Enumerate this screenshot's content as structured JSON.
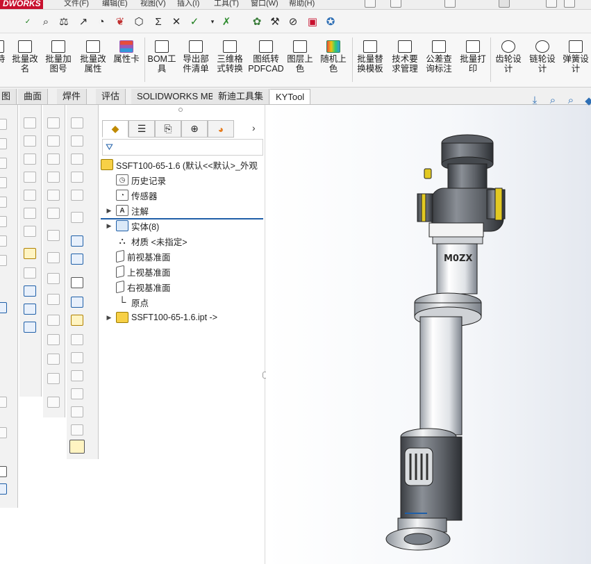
{
  "app": {
    "logo_text": "DWORKS"
  },
  "menu": {
    "items": [
      "文件(F)",
      "编辑(E)",
      "视图(V)",
      "插入(I)",
      "工具(T)",
      "窗口(W)",
      "帮助(H)"
    ]
  },
  "ribbon": {
    "buttons": [
      {
        "label": "持",
        "icon": "partial-icon"
      },
      {
        "label": "批量改\n名",
        "icon": "rename-icon"
      },
      {
        "label": "批量加\n图号",
        "icon": "edit-pencil-icon"
      },
      {
        "label": "批量改\n属性",
        "icon": "list-icon"
      },
      {
        "label": "属性卡",
        "icon": "property-card-icon"
      },
      {
        "label": "BOM工\n具",
        "icon": "table-icon"
      },
      {
        "label": "导出部\n件清单",
        "icon": "export-list-icon"
      },
      {
        "label": "三维格\n式转换",
        "icon": "format-convert-icon"
      },
      {
        "label": "图纸转\nPDFCAD",
        "icon": "pdf-icon"
      },
      {
        "label": "图层上\n色",
        "icon": "layers-icon"
      },
      {
        "label": "随机上\n色",
        "icon": "palette-icon"
      },
      {
        "label": "批量替\n换模板",
        "icon": "template-icon"
      },
      {
        "label": "技术要\n求管理",
        "icon": "requirement-icon"
      },
      {
        "label": "公差查\n询标注",
        "icon": "tolerance-icon"
      },
      {
        "label": "批量打\n印",
        "icon": "printer-icon"
      },
      {
        "label": "齿轮设\n计",
        "icon": "gear-icon"
      },
      {
        "label": "链轮设\n计",
        "icon": "chain-icon"
      },
      {
        "label": "弹簧设\n计",
        "icon": "spring-icon"
      }
    ]
  },
  "tabs": [
    {
      "label": "图",
      "active": false
    },
    {
      "label": "曲面",
      "active": false
    },
    {
      "label": "焊件",
      "active": false
    },
    {
      "label": "评估",
      "active": false
    },
    {
      "label": "SOLIDWORKS MBD",
      "active": false
    },
    {
      "label": "新迪工具集",
      "active": false
    },
    {
      "label": "KYTool",
      "active": true
    }
  ],
  "feature_tree": {
    "root": "SSFT100-65-1.6  (默认<<默认>_外观",
    "items": [
      {
        "label": "历史记录",
        "icon": "history-icon",
        "expandable": false
      },
      {
        "label": "传感器",
        "icon": "sensor-icon",
        "expandable": false
      },
      {
        "label": "注解",
        "icon": "annotation-icon",
        "expandable": true
      },
      {
        "label": "实体(8)",
        "icon": "solid-bodies-icon",
        "expandable": true
      },
      {
        "label": "材质 <未指定>",
        "icon": "material-icon",
        "expandable": false
      },
      {
        "label": "前视基准面",
        "icon": "plane-icon",
        "expandable": false
      },
      {
        "label": "上视基准面",
        "icon": "plane-icon",
        "expandable": false
      },
      {
        "label": "右视基准面",
        "icon": "plane-icon",
        "expandable": false
      },
      {
        "label": "原点",
        "icon": "origin-icon",
        "expandable": false
      },
      {
        "label": "SSFT100-65-1.6.ipt ->",
        "icon": "part-icon",
        "expandable": true
      }
    ]
  },
  "model": {
    "engraved_text": "M0ZX"
  }
}
